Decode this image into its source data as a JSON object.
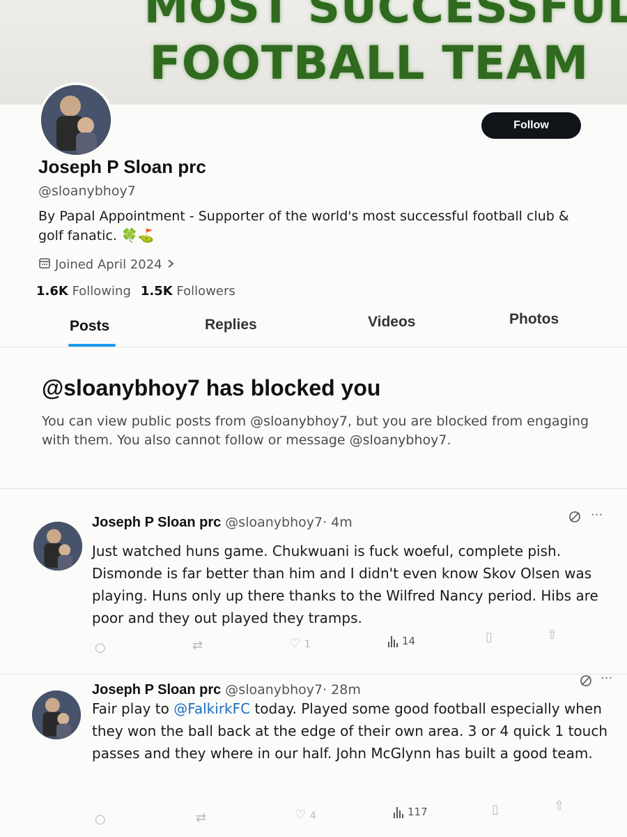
{
  "banner": {
    "line1": "MOST SUCCESSFUL",
    "line2": "FOOTBALL TEAM"
  },
  "profile": {
    "display_name": "Joseph P Sloan prc",
    "handle": "@sloanybhoy7",
    "bio": "By Papal Appointment - Supporter of the world's most successful football club & golf fanatic. 🍀⛳",
    "joined": "Joined April 2024",
    "following_count": "1.6K",
    "following_label": "Following",
    "followers_count": "1.5K",
    "followers_label": "Followers",
    "follow_label": "Follow"
  },
  "tabs": [
    {
      "label": "Posts",
      "active": true
    },
    {
      "label": "Replies",
      "active": false
    },
    {
      "label": "Videos",
      "active": false
    },
    {
      "label": "Photos",
      "active": false
    }
  ],
  "blocked": {
    "title": "@sloanybhoy7 has blocked you",
    "message": "You can view public posts from @sloanybhoy7, but you are blocked from engaging with them. You also cannot follow or message @sloanybhoy7."
  },
  "posts": [
    {
      "name": "Joseph P Sloan prc",
      "handle": "@sloanybhoy7",
      "time": "· 4m",
      "text": "Just watched huns game. Chukwuani is fuck woeful, complete pish. Dismonde is far better than him and I didn't even know Skov Olsen was playing. Huns only up there thanks to the Wilfred Nancy period. Hibs are poor and they out played they tramps.",
      "likes": "1",
      "views": "14"
    },
    {
      "name": "Joseph P Sloan prc",
      "handle": "@sloanybhoy7",
      "time": "· 28m",
      "text_before": "Fair play to ",
      "mention": "@FalkirkFC",
      "text_after": " today. Played some good football especially when they won the ball back at the edge of their own area. 3 or 4 quick 1 touch passes and they where in our half. John McGlynn has built a good team.",
      "likes": "4",
      "views": "117"
    }
  ],
  "colors": {
    "accent": "#1d9bf0",
    "banner_text": "#2f6a1e",
    "follow_bg": "#0f1419"
  }
}
